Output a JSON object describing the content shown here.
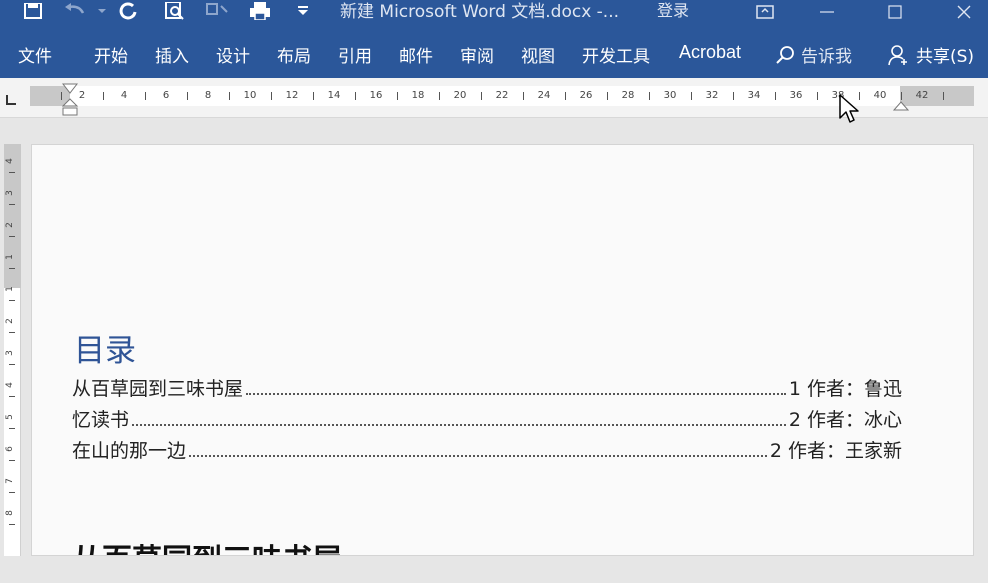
{
  "title_bar": {
    "document_title": "新建 Microsoft Word 文档.docx -...",
    "login_label": "登录",
    "quick_access_icons": [
      "save-icon",
      "undo-icon",
      "redo-icon",
      "print-preview-icon",
      "touch-mode-icon",
      "printer-icon",
      "customize-icon"
    ]
  },
  "ribbon": {
    "tabs": [
      "文件",
      "开始",
      "插入",
      "设计",
      "布局",
      "引用",
      "邮件",
      "审阅",
      "视图",
      "开发工具",
      "Acrobat"
    ],
    "tell_me": "告诉我",
    "share": "共享(S)"
  },
  "ruler": {
    "labels": [
      "2",
      "4",
      "6",
      "8",
      "10",
      "12",
      "14",
      "16",
      "18",
      "20",
      "22",
      "24",
      "26",
      "28",
      "30",
      "32",
      "34",
      "36",
      "38",
      "40",
      "42"
    ],
    "vertical_labels": [
      "4",
      "3",
      "2",
      "1",
      "1",
      "2",
      "3",
      "4",
      "5",
      "6",
      "7",
      "8"
    ]
  },
  "document": {
    "toc_heading": "目录",
    "toc_entries": [
      {
        "title": "从百草园到三味书屋",
        "page": "1 作者：鲁迅"
      },
      {
        "title": "忆读书",
        "page": "2 作者：冰心"
      },
      {
        "title": "在山的那一边",
        "page": "2 作者：王家新"
      }
    ],
    "first_heading": "从百草园到三味书屋"
  },
  "colors": {
    "ribbon_blue": "#2b579a",
    "heading_blue": "#2f5496"
  }
}
